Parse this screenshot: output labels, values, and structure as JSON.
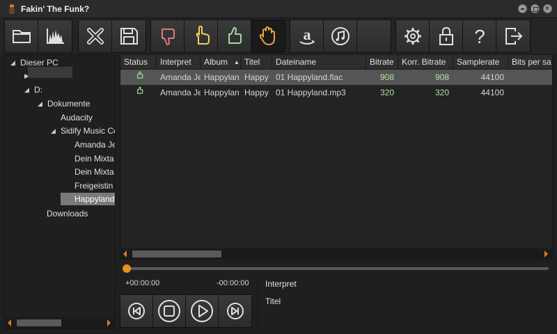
{
  "window": {
    "title": "Fakin' The Funk?"
  },
  "toolbar": {
    "groups": [
      [
        "folder-icon",
        "spectrum-icon"
      ],
      [
        "delete-icon",
        "save-icon"
      ],
      [
        "thumbs-down-icon",
        "pointing-hand-icon",
        "thumbs-up-icon",
        "stop-hand-icon"
      ],
      [
        "amazon-icon",
        "itunes-icon",
        "empty"
      ],
      [
        "gear-icon",
        "lock-icon",
        "help-icon",
        "exit-icon"
      ]
    ]
  },
  "tree": {
    "items": [
      {
        "label": "Dieser PC",
        "arrow": "◢"
      },
      {
        "label": "",
        "arrow": "▶"
      },
      {
        "label": "D:",
        "arrow": "◢"
      },
      {
        "label": "Dokumente",
        "arrow": "◢"
      },
      {
        "label": "Audacity",
        "arrow": ""
      },
      {
        "label": "Sidify Music Co",
        "arrow": "◢"
      },
      {
        "label": "Amanda Je",
        "arrow": ""
      },
      {
        "label": "Dein Mixta",
        "arrow": ""
      },
      {
        "label": "Dein Mixta",
        "arrow": ""
      },
      {
        "label": "Freigeistin",
        "arrow": ""
      },
      {
        "label": "Happyland",
        "arrow": ""
      },
      {
        "label": "Downloads",
        "arrow": ""
      }
    ]
  },
  "table": {
    "columns": [
      "Status",
      "Interpret",
      "Album",
      "Titel",
      "Dateiname",
      "Bitrate",
      "Korr. Bitrate",
      "Samplerate",
      "Bits per sa"
    ],
    "sort_indicator": "▲",
    "rows": [
      {
        "interpret": "Amanda Je",
        "album": "Happylan",
        "titel": "Happy",
        "dateiname": "01 Happyland.flac",
        "bitrate": "908",
        "korr_bitrate": "908",
        "samplerate": "44100"
      },
      {
        "interpret": "Amanda Je",
        "album": "Happylan",
        "titel": "Happy",
        "dateiname": "01 Happyland.mp3",
        "bitrate": "320",
        "korr_bitrate": "320",
        "samplerate": "44100"
      }
    ]
  },
  "player": {
    "time_elapsed": "+00:00:00",
    "time_remaining": "-00:00:00",
    "progress": 0,
    "controls": [
      "previous-icon",
      "stop-icon",
      "play-icon",
      "next-icon"
    ]
  },
  "info": {
    "interpret_label": "Interpret",
    "titel_label": "Titel"
  },
  "colors": {
    "accent": "#e8901c",
    "numeric_text": "#b0e4a0",
    "thumbs_down": "#e07a7a",
    "pointing_hand": "#f0d060",
    "thumbs_up": "#a6dba0",
    "stop_hand": "#f0a040"
  }
}
